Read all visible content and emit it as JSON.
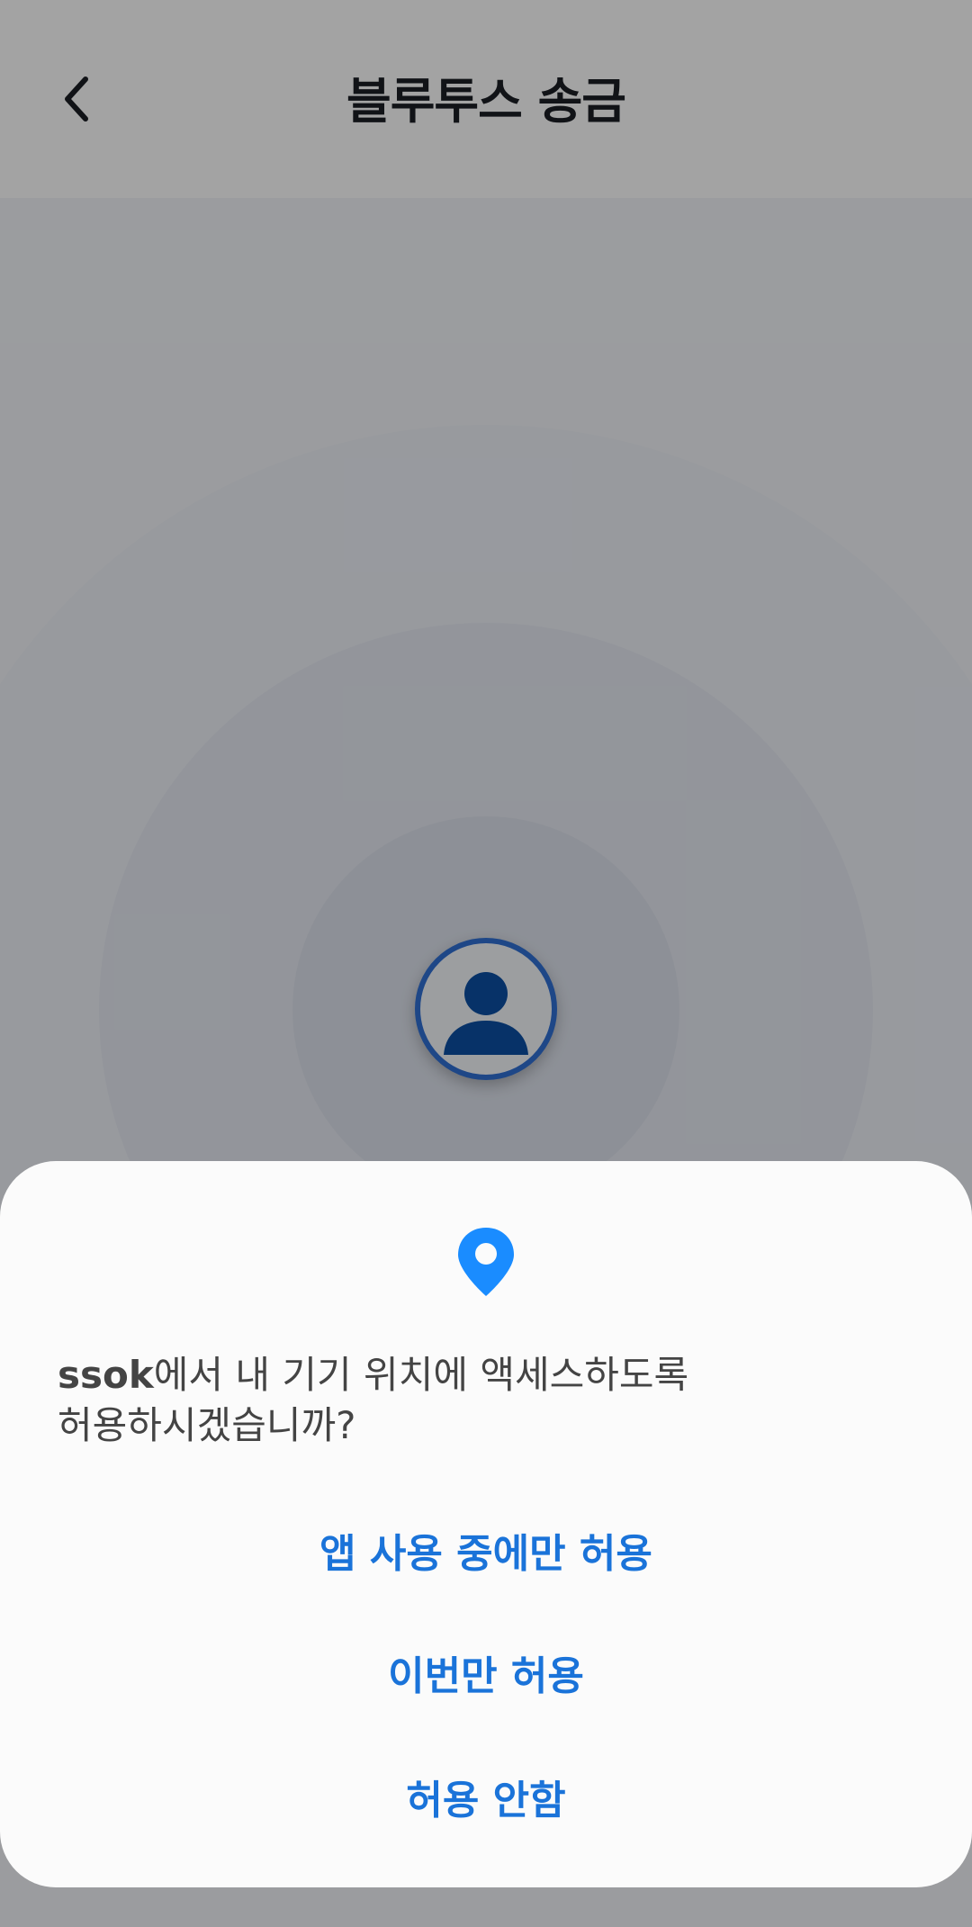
{
  "header": {
    "title": "블루투스 송금",
    "back_icon": "chevron-left-icon"
  },
  "radar": {
    "avatar_icon": "person-icon",
    "accent_color": "#2f6fd4"
  },
  "permission_dialog": {
    "icon": "location-pin-icon",
    "icon_color": "#1a8cff",
    "app_name": "ssok",
    "message_line1_rest": "에서 내 기기 위치에 액세스하도록",
    "message_line2": "허용하시겠습니까?",
    "options": [
      {
        "label": "앱 사용 중에만 허용"
      },
      {
        "label": "이번만 허용"
      },
      {
        "label": "허용 안함"
      }
    ],
    "option_color": "#1a73d9"
  }
}
